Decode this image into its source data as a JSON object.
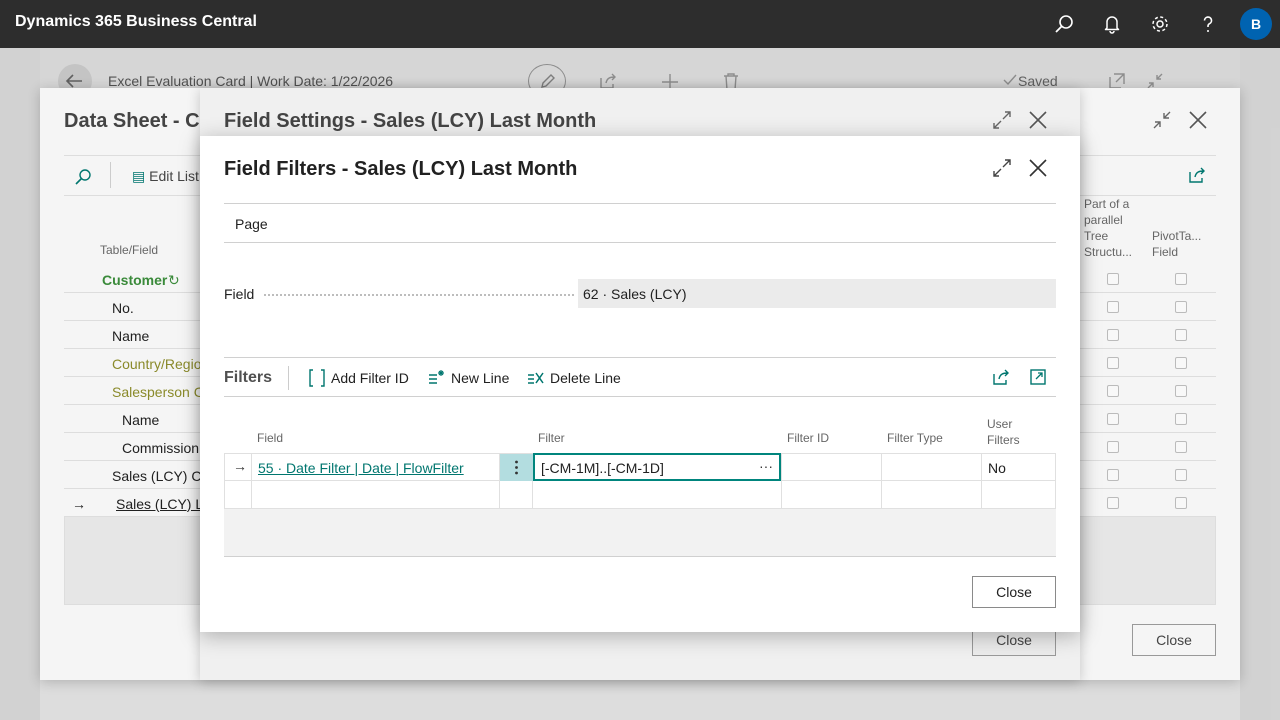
{
  "app": {
    "title": "Dynamics 365 Business Central",
    "user_initial": "B"
  },
  "icons": {
    "search": "search-icon",
    "bell": "bell-icon",
    "settings": "gear-icon",
    "help": "help-icon"
  },
  "background_page": {
    "title": "Excel Evaluation Card | Work Date: 1/22/2026",
    "saved_label": "Saved"
  },
  "data_sheet": {
    "title": "Data Sheet - Cu",
    "edit_list_label": "Edit List",
    "col_table_field": "Table/Field",
    "col_parallel": "Part of a parallel Tree Structu...",
    "col_pivot": "PivotTa... Field",
    "rows": [
      {
        "label": "Customer"
      },
      {
        "label": "No."
      },
      {
        "label": "Name"
      },
      {
        "label": "Country/Regio"
      },
      {
        "label": "Salesperson Co"
      },
      {
        "label": "Name"
      },
      {
        "label": "Commission"
      },
      {
        "label": "Sales (LCY) Cur"
      },
      {
        "label": "Sales (LCY) La"
      }
    ],
    "close_label": "Close"
  },
  "field_settings": {
    "title": "Field Settings - Sales (LCY) Last Month",
    "close_label": "Close"
  },
  "field_filters": {
    "title": "Field Filters - Sales (LCY) Last Month",
    "page_label": "Page",
    "field_label": "Field",
    "field_value": "62 · Sales (LCY)",
    "filters_label": "Filters",
    "actions": {
      "add_filter_id": "Add Filter ID",
      "new_line": "New Line",
      "delete_line": "Delete Line"
    },
    "columns": {
      "field": "Field",
      "filter": "Filter",
      "filter_id": "Filter ID",
      "filter_type": "Filter Type",
      "user_filters": "User Filters"
    },
    "rows": [
      {
        "field": "55 · Date Filter | Date | FlowFilter",
        "filter": "[-CM-1M]..[-CM-1D]",
        "filter_id": "",
        "filter_type": "",
        "user_filters": "No"
      }
    ],
    "close_label": "Close"
  },
  "colors": {
    "appbar": "#2d2d2d",
    "accent": "#00857d",
    "link": "#00766f",
    "avatar": "#0063b1",
    "customer_green": "#3a8a3a",
    "olive": "#8a8a2a"
  }
}
